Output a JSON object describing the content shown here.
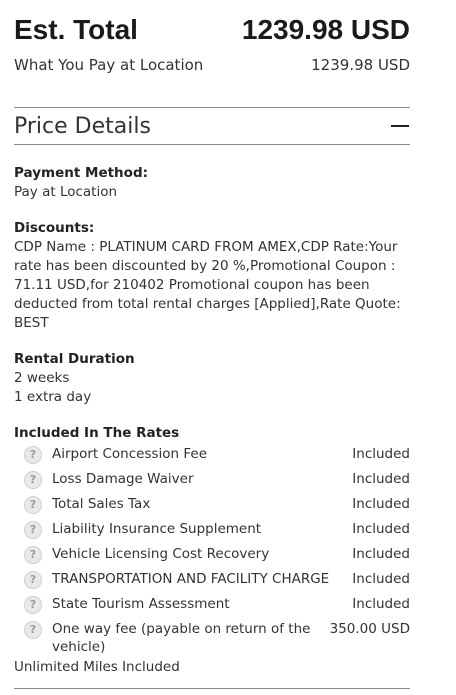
{
  "summary": {
    "est_total_label": "Est. Total",
    "est_total_amount": "1239.98 USD",
    "pay_location_label": "What You Pay at Location",
    "pay_location_amount": "1239.98 USD"
  },
  "price_details": {
    "title": "Price Details",
    "collapse_icon": "minus-icon",
    "payment_method": {
      "label": "Payment Method:",
      "value": "Pay at Location"
    },
    "discounts": {
      "label": "Discounts:",
      "value": "CDP Name : PLATINUM CARD FROM AMEX,CDP Rate:Your rate has been discounted by 20 %,Promotional Coupon : 71.11 USD,for 210402 Promotional coupon has been deducted from total rental charges [Applied],Rate Quote: BEST"
    },
    "rental_duration": {
      "label": "Rental Duration",
      "lines": [
        "2 weeks",
        "1 extra day"
      ]
    },
    "included": {
      "label": "Included In The Rates",
      "items": [
        {
          "name": "Airport Concession Fee",
          "value": "Included"
        },
        {
          "name": "Loss Damage Waiver",
          "value": "Included"
        },
        {
          "name": "Total Sales Tax",
          "value": "Included"
        },
        {
          "name": "Liability Insurance Supplement",
          "value": "Included"
        },
        {
          "name": "Vehicle Licensing Cost Recovery",
          "value": "Included"
        },
        {
          "name": "TRANSPORTATION AND FACILITY CHARGE",
          "value": "Included"
        },
        {
          "name": "State Tourism Assessment",
          "value": "Included"
        },
        {
          "name": "One way fee (payable on return of the vehicle)",
          "value": "350.00 USD"
        }
      ]
    },
    "footer_note": "Unlimited Miles Included"
  }
}
